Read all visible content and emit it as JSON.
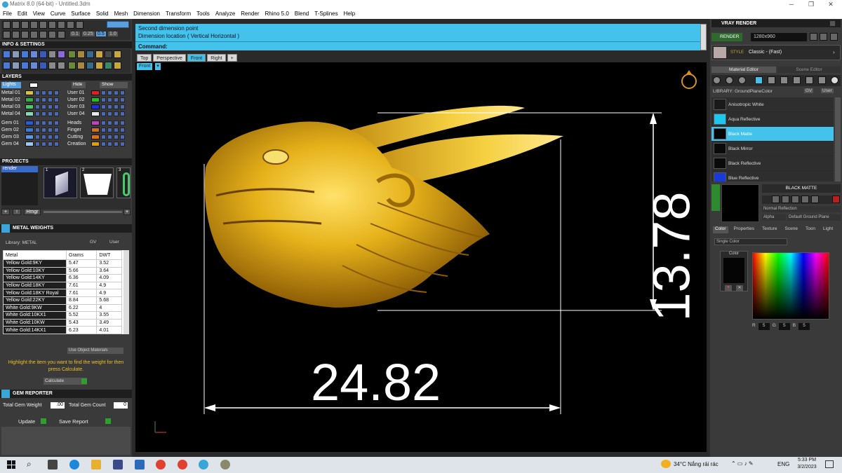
{
  "window": {
    "title": "Matrix 8.0 (64-bit) - Untitled.3dm"
  },
  "menu": [
    "File",
    "Edit",
    "View",
    "Curve",
    "Surface",
    "Solid",
    "Mesh",
    "Dimension",
    "Transform",
    "Tools",
    "Analyze",
    "Render",
    "Rhino 5.0",
    "Blend",
    "T-Splines",
    "Help"
  ],
  "toolbar": {
    "numbers": [
      "0.1",
      "0.25",
      "0.5",
      "1.0"
    ]
  },
  "info_settings": {
    "title": "INFO & SETTINGS"
  },
  "layers": {
    "title": "LAYERS",
    "lights_label": "Lights",
    "hide_label": "Hide",
    "show_label": "Show",
    "left": [
      {
        "name": "Metal 01",
        "color": "#d8c23a"
      },
      {
        "name": "Metal 02",
        "color": "#2bb34a"
      },
      {
        "name": "Metal 03",
        "color": "#4ac86a"
      },
      {
        "name": "Metal 04",
        "color": "#8ad8b8"
      },
      {
        "name": "Gem 01",
        "color": "#2a5ad8"
      },
      {
        "name": "Gem 02",
        "color": "#3a7ad8"
      },
      {
        "name": "Gem 03",
        "color": "#5a9ae8"
      },
      {
        "name": "Gem 04",
        "color": "#9ac8f8"
      }
    ],
    "right": [
      {
        "name": "User 01",
        "color": "#e02020"
      },
      {
        "name": "User 02",
        "color": "#20c020"
      },
      {
        "name": "User 03",
        "color": "#2030e0"
      },
      {
        "name": "User 04",
        "color": "#e8e8e8"
      },
      {
        "name": "Heads",
        "color": "#c040c0"
      },
      {
        "name": "Finger",
        "color": "#d07020"
      },
      {
        "name": "Cutting",
        "color": "#e07010"
      },
      {
        "name": "Creation",
        "color": "#e0a000"
      }
    ]
  },
  "projects": {
    "title": "PROJECTS",
    "item": "render",
    "thumbs": [
      "1",
      "2",
      "3"
    ],
    "btn_hmgr": "Hmgr"
  },
  "metal_weights": {
    "title": "METAL WEIGHTS",
    "library_label": "Library: METAL",
    "gv": "GV",
    "user": "User",
    "headers": [
      "Metal",
      "Grams",
      "DWT"
    ],
    "rows": [
      [
        "Yellow Gold:9KY",
        "5.47",
        "3.52"
      ],
      [
        "Yellow Gold:10KY",
        "5.66",
        "3.64"
      ],
      [
        "Yellow Gold:14KY",
        "6.36",
        "4.09"
      ],
      [
        "Yellow Gold:18KY",
        "7.61",
        "4.9"
      ],
      [
        "Yellow Gold:18KY Royal",
        "7.61",
        "4.9"
      ],
      [
        "Yellow Gold:22KY",
        "8.84",
        "5.68"
      ],
      [
        "White Gold:9KW",
        "6.22",
        "4"
      ],
      [
        "White Gold:10KX1",
        "5.52",
        "3.55"
      ],
      [
        "White Gold:10KW",
        "5.43",
        "3.49"
      ],
      [
        "White Gold:14KX1",
        "6.23",
        "4.01"
      ]
    ],
    "use_obj_label": "Use Object Materials",
    "hint": "Highlight the item you want to find the weight for then press Calculate.",
    "calc_label": "Calculate"
  },
  "gem_reporter": {
    "title": "GEM REPORTER",
    "total_weight_label": "Total Gem Weight",
    "total_weight_value": ".00",
    "total_count_label": "Total Gem Count",
    "total_count_value": "0",
    "update_label": "Update",
    "save_label": "Save Report"
  },
  "command": {
    "line1": "Second dimension point",
    "line2": "Dimension location ( Vertical  Horizontal )",
    "prompt": "Command:"
  },
  "viewport_tabs": [
    "Top",
    "Perspective",
    "Front",
    "Right",
    "+"
  ],
  "active_viewport": "Front",
  "dimensions": {
    "horizontal": "24.82",
    "vertical": "13.78"
  },
  "vray": {
    "title": "VRAY RENDER",
    "render_label": "RENDER",
    "resolution": "1280x960",
    "style_prefix": "STYLE",
    "style": "Classic - (Fast)",
    "tab_material": "Material Editor",
    "tab_scene": "Scene Editor",
    "library_label": "LIBRARY: GroundPlaneColor",
    "gv": "GV",
    "user": "User",
    "materials": [
      {
        "name": "Anisotropic White",
        "color": "#1a1a1a"
      },
      {
        "name": "Aqua Reflective",
        "color": "#1ec7ee"
      },
      {
        "name": "Black Matte",
        "color": "#050505"
      },
      {
        "name": "Black Mirror",
        "color": "#0a0a0a"
      },
      {
        "name": "Black Reflective",
        "color": "#0a0a0a"
      },
      {
        "name": "Blue Reflective",
        "color": "#1a3ad8"
      }
    ],
    "selected_material": "BLACK MATTE",
    "normal_reflection": "Normal Reflection",
    "alpha_label": "Alpha",
    "ground_plane": "Default Ground Plane",
    "prop_tabs": [
      "Color",
      "Properties",
      "Texture",
      "Scene",
      "Toon",
      "Light"
    ],
    "color_mode": "Single Color",
    "color_label": "Color",
    "r": "5",
    "g": "5",
    "b": "5",
    "r_label": "R",
    "g_label": "G",
    "b_label": "B"
  },
  "taskbar": {
    "weather": "34°C  Nắng rải rác",
    "lang": "ENG",
    "time": "5:33 PM",
    "date": "3/2/2023"
  }
}
